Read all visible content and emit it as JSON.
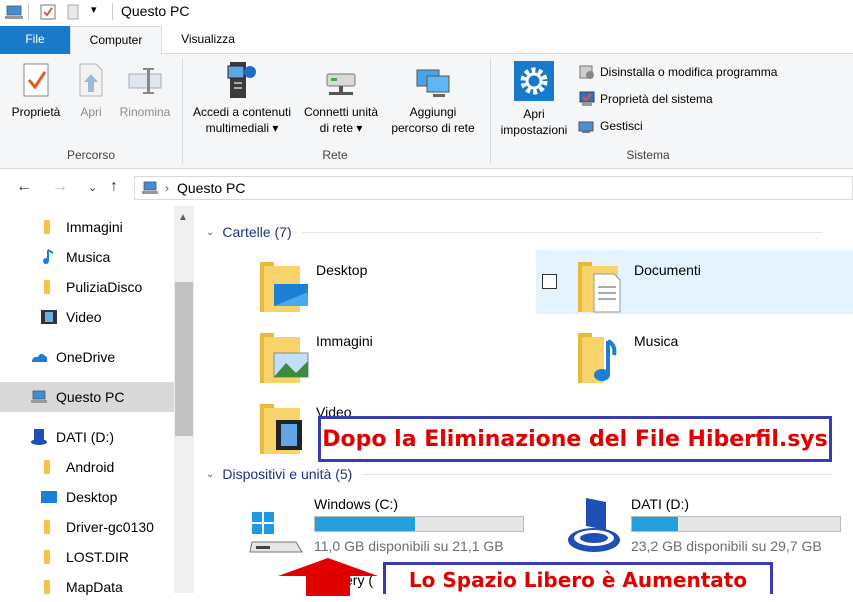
{
  "window": {
    "title": "Questo PC"
  },
  "tabs": {
    "file": "File",
    "computer": "Computer",
    "view": "Visualizza"
  },
  "ribbon": {
    "proprieta": "Proprietà",
    "apri": "Apri",
    "rinomina": "Rinomina",
    "group_percorso": "Percorso",
    "accedi_line1": "Accedi a contenuti",
    "accedi_line2": "multimediali",
    "connetti_line1": "Connetti unità",
    "connetti_line2": "di rete",
    "aggiungi_line1": "Aggiungi",
    "aggiungi_line2": "percorso di rete",
    "group_rete": "Rete",
    "apri_imp_line1": "Apri",
    "apri_imp_line2": "impostazioni",
    "disinstalla": "Disinstalla o modifica programma",
    "proprieta_sistema": "Proprietà del sistema",
    "gestisci": "Gestisci",
    "group_sistema": "Sistema"
  },
  "address": {
    "path": "Questo PC"
  },
  "nav": {
    "items": [
      {
        "label": "Immagini"
      },
      {
        "label": "Musica"
      },
      {
        "label": "PuliziaDisco"
      },
      {
        "label": "Video"
      },
      {
        "label": "OneDrive"
      },
      {
        "label": "Questo PC"
      },
      {
        "label": "DATI (D:)"
      },
      {
        "label": "Android"
      },
      {
        "label": "Desktop"
      },
      {
        "label": "Driver-gc0130"
      },
      {
        "label": "LOST.DIR"
      },
      {
        "label": "MapData"
      }
    ]
  },
  "content": {
    "folders_header": "Cartelle (7)",
    "folders": [
      {
        "name": "Desktop"
      },
      {
        "name": "Documenti"
      },
      {
        "name": "Immagini"
      },
      {
        "name": "Musica"
      },
      {
        "name": "Video"
      }
    ],
    "devices_header": "Dispositivi e unità (5)",
    "drives": [
      {
        "name": "Windows (C:)",
        "free": "11,0 GB disponibili su 21,1 GB",
        "used_fraction": 0.48
      },
      {
        "name": "DATI (D:)",
        "free": "23,2 GB disponibili su 29,7 GB",
        "used_fraction": 0.22
      }
    ],
    "partial_drive_label": "very ("
  },
  "annotations": {
    "top": "Dopo la Eliminazione del File Hiberfil.sys",
    "bottom": "Lo Spazio Libero è Aumentato"
  },
  "colors": {
    "accent": "#1979ca",
    "annotation_text": "#e00000",
    "annotation_border": "#3b3bb3",
    "drive_bar": "#26a0da"
  }
}
